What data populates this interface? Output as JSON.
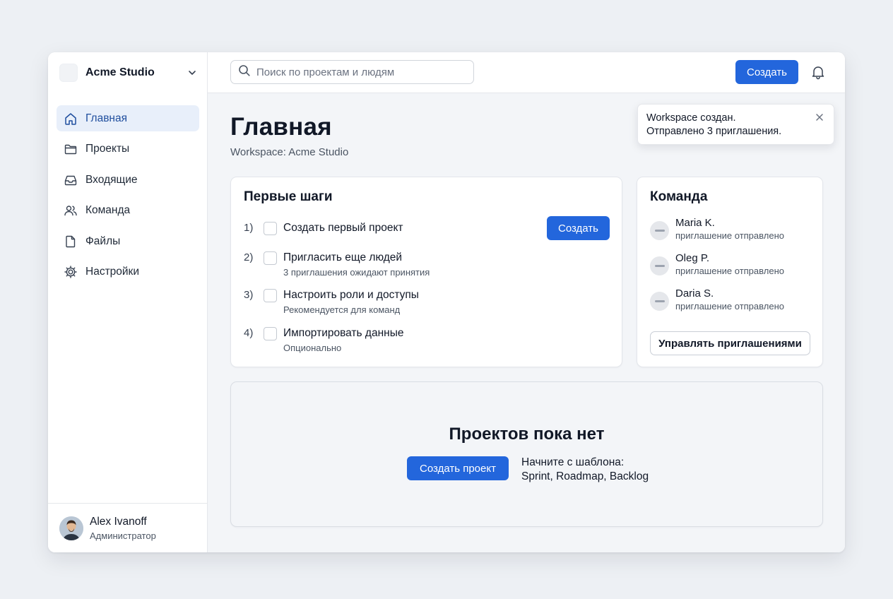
{
  "workspace": {
    "name": "Acme Studio"
  },
  "nav": [
    {
      "label": "Главная",
      "icon": "home-icon",
      "active": true
    },
    {
      "label": "Проекты",
      "icon": "folder-icon",
      "active": false
    },
    {
      "label": "Входящие",
      "icon": "inbox-icon",
      "active": false
    },
    {
      "label": "Команда",
      "icon": "users-icon",
      "active": false
    },
    {
      "label": "Файлы",
      "icon": "file-icon",
      "active": false
    },
    {
      "label": "Настройки",
      "icon": "gear-icon",
      "active": false
    }
  ],
  "user": {
    "name": "Alex Ivanoff",
    "role": "Администратор"
  },
  "search": {
    "placeholder": "Поиск по проектам и людям"
  },
  "topbar": {
    "create_label": "Создать"
  },
  "page": {
    "title": "Главная",
    "subtitle": "Workspace: Acme Studio"
  },
  "toast": {
    "line1": "Workspace создан.",
    "line2": "Отправлено 3 приглашения."
  },
  "steps": {
    "title": "Первые шаги",
    "create_label": "Создать",
    "items": [
      {
        "num": "1)",
        "label": "Создать первый проект",
        "hint": ""
      },
      {
        "num": "2)",
        "label": "Пригласить еще людей",
        "hint": "3 приглашения ожидают принятия"
      },
      {
        "num": "3)",
        "label": "Настроить роли и доступы",
        "hint": "Рекомендуется для команд"
      },
      {
        "num": "4)",
        "label": "Импортировать данные",
        "hint": "Опционально"
      }
    ]
  },
  "team": {
    "title": "Команда",
    "members": [
      {
        "name": "Maria K.",
        "status": "приглашение отправлено"
      },
      {
        "name": "Oleg P.",
        "status": "приглашение отправлено"
      },
      {
        "name": "Daria S.",
        "status": "приглашение отправлено"
      }
    ],
    "manage_label": "Управлять приглашениями"
  },
  "empty": {
    "title": "Проектов пока нет",
    "create_label": "Создать проект",
    "hint_line1": "Начните с шаблона:",
    "hint_line2": "Sprint, Roadmap, Backlog"
  },
  "colors": {
    "accent": "#2366dc",
    "active_nav_bg": "#e8effa",
    "active_nav_text": "#1f4e9e"
  }
}
